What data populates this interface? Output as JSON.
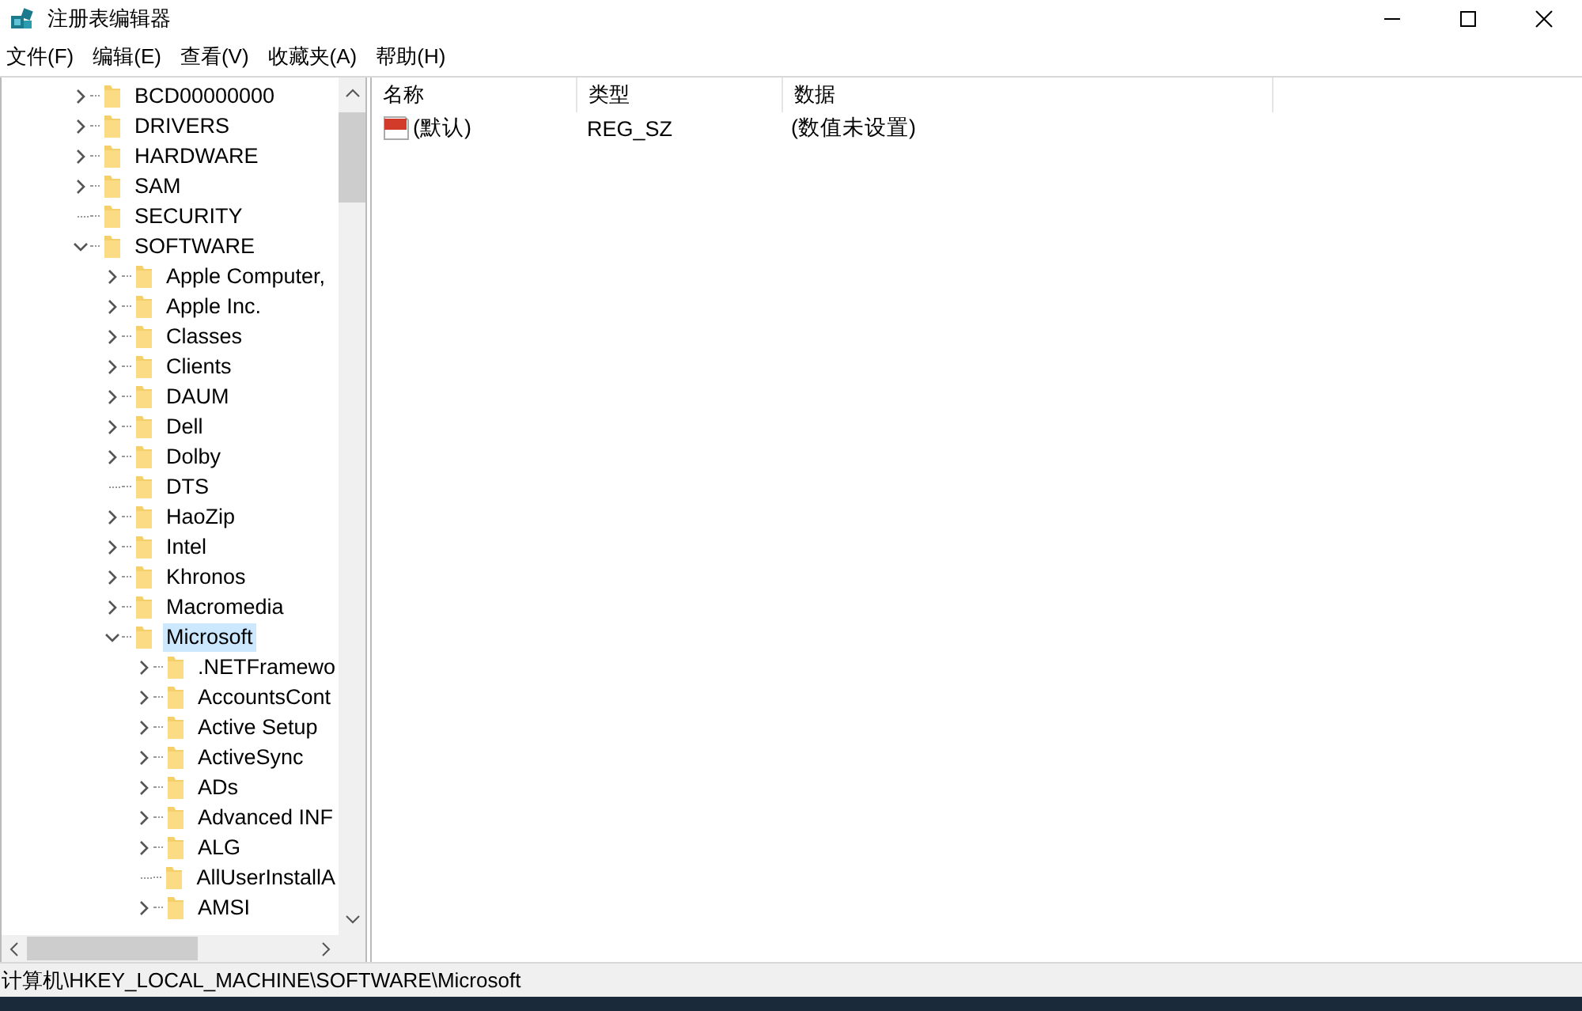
{
  "window": {
    "title": "注册表编辑器"
  },
  "menu": [
    "文件(F)",
    "编辑(E)",
    "查看(V)",
    "收藏夹(A)",
    "帮助(H)"
  ],
  "tree": [
    {
      "label": "BCD00000000",
      "kind": "branch",
      "expanded": false,
      "selected": false
    },
    {
      "label": "DRIVERS",
      "kind": "branch",
      "expanded": false,
      "selected": false
    },
    {
      "label": "HARDWARE",
      "kind": "branch",
      "expanded": false,
      "selected": false
    },
    {
      "label": "SAM",
      "kind": "branch",
      "expanded": false,
      "selected": false
    },
    {
      "label": "SECURITY",
      "kind": "leaf",
      "selected": false
    },
    {
      "label": "SOFTWARE",
      "kind": "branch",
      "expanded": true,
      "selected": false,
      "children": [
        {
          "label": "Apple Computer,",
          "kind": "branch",
          "expanded": false,
          "selected": false
        },
        {
          "label": "Apple Inc.",
          "kind": "branch",
          "expanded": false,
          "selected": false
        },
        {
          "label": "Classes",
          "kind": "branch",
          "expanded": false,
          "selected": false
        },
        {
          "label": "Clients",
          "kind": "branch",
          "expanded": false,
          "selected": false
        },
        {
          "label": "DAUM",
          "kind": "branch",
          "expanded": false,
          "selected": false
        },
        {
          "label": "Dell",
          "kind": "branch",
          "expanded": false,
          "selected": false
        },
        {
          "label": "Dolby",
          "kind": "branch",
          "expanded": false,
          "selected": false
        },
        {
          "label": "DTS",
          "kind": "leaf",
          "selected": false
        },
        {
          "label": "HaoZip",
          "kind": "branch",
          "expanded": false,
          "selected": false
        },
        {
          "label": "Intel",
          "kind": "branch",
          "expanded": false,
          "selected": false
        },
        {
          "label": "Khronos",
          "kind": "branch",
          "expanded": false,
          "selected": false
        },
        {
          "label": "Macromedia",
          "kind": "branch",
          "expanded": false,
          "selected": false
        },
        {
          "label": "Microsoft",
          "kind": "branch",
          "expanded": true,
          "selected": true,
          "children": [
            {
              "label": ".NETFramewo",
              "kind": "branch",
              "expanded": false,
              "selected": false
            },
            {
              "label": "AccountsCont",
              "kind": "branch",
              "expanded": false,
              "selected": false
            },
            {
              "label": "Active Setup",
              "kind": "branch",
              "expanded": false,
              "selected": false
            },
            {
              "label": "ActiveSync",
              "kind": "branch",
              "expanded": false,
              "selected": false
            },
            {
              "label": "ADs",
              "kind": "branch",
              "expanded": false,
              "selected": false
            },
            {
              "label": "Advanced INF",
              "kind": "branch",
              "expanded": false,
              "selected": false
            },
            {
              "label": "ALG",
              "kind": "branch",
              "expanded": false,
              "selected": false
            },
            {
              "label": "AllUserInstallA",
              "kind": "leaf",
              "selected": false
            },
            {
              "label": "AMSI",
              "kind": "branch",
              "expanded": false,
              "selected": false
            }
          ]
        }
      ]
    }
  ],
  "values": {
    "columns": [
      "名称",
      "类型",
      "数据"
    ],
    "rows": [
      {
        "name": "(默认)",
        "type": "REG_SZ",
        "data": "(数值未设置)"
      }
    ]
  },
  "status_bar": "计算机\\HKEY_LOCAL_MACHINE\\SOFTWARE\\Microsoft"
}
